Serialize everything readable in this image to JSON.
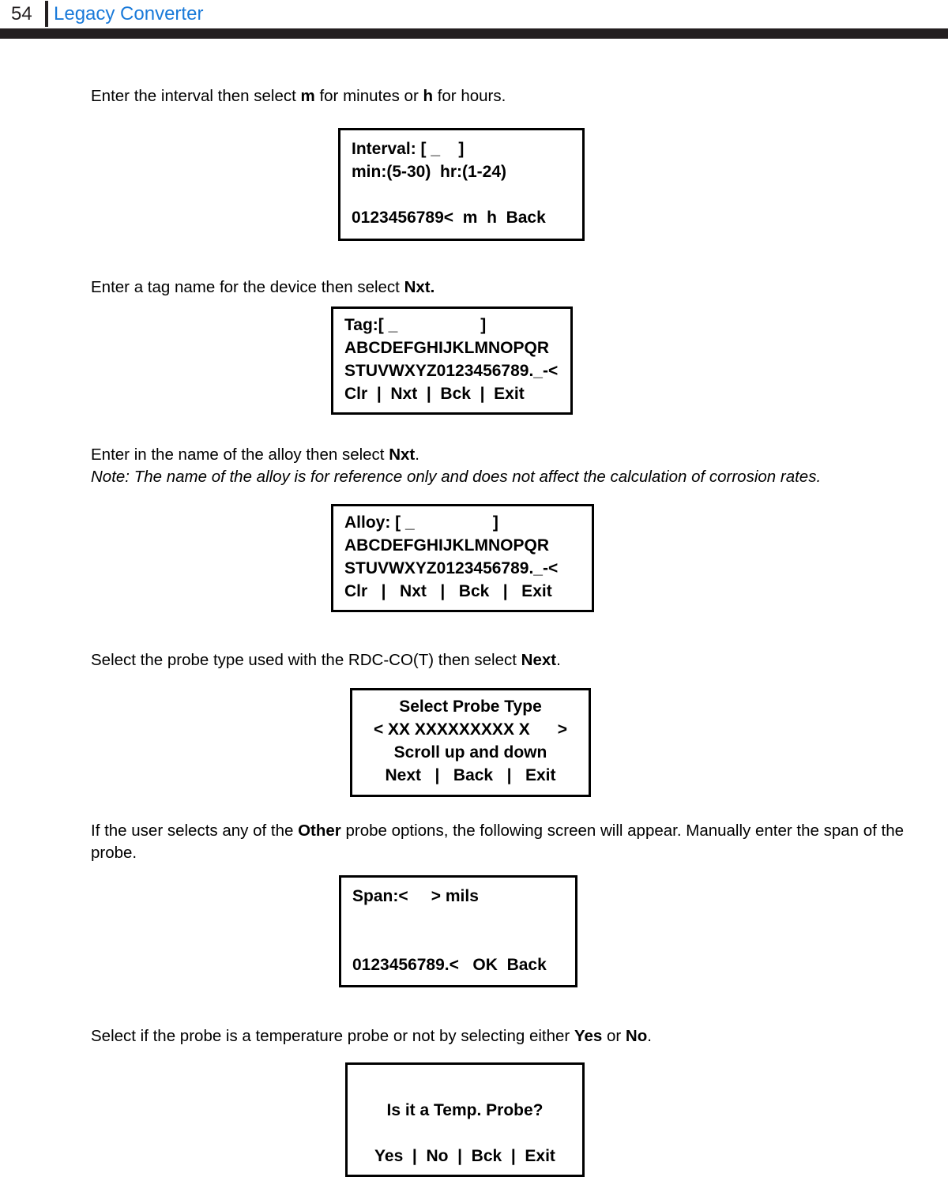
{
  "header": {
    "page_number": "54",
    "title": "Legacy Converter",
    "accent_color": "#1a7ad9",
    "bar_color": "#231f20"
  },
  "sections": [
    {
      "id": "interval",
      "paragraph_parts": {
        "p1": "Enter the interval then select ",
        "b1": "m",
        "p2": " for minutes or ",
        "b2": "h",
        "p3": " for hours."
      },
      "screen": {
        "name": "interval-screen",
        "lines": [
          "Interval: [ _    ]",
          "min:(5-30)  hr:(1-24)",
          "",
          "0123456789<  m  h  Back"
        ]
      }
    },
    {
      "id": "tag",
      "paragraph_parts": {
        "p1": "Enter a tag name for the device then select ",
        "b1": "Nxt.",
        "p2": ""
      },
      "screen": {
        "name": "tag-screen",
        "lines": [
          "Tag:[ _                  ]",
          "ABCDEFGHIJKLMNOPQR",
          "STUVWXYZ0123456789._-<",
          "Clr  |  Nxt  |  Bck  |  Exit"
        ]
      }
    },
    {
      "id": "alloy",
      "paragraph_parts": {
        "p1": "Enter in the name of the alloy then select ",
        "b1": "Nxt",
        "p2": "."
      },
      "note": "Note: The name of the alloy is for reference only and does not affect the calculation of corrosion rates.",
      "screen": {
        "name": "alloy-screen",
        "lines": [
          "Alloy: [ _                 ]",
          "ABCDEFGHIJKLMNOPQR",
          "STUVWXYZ0123456789._-<",
          "Clr   |   Nxt   |   Bck   |   Exit"
        ]
      }
    },
    {
      "id": "probe-type",
      "paragraph_parts": {
        "p1": "Select the probe type used with the RDC-CO(T) then select ",
        "b1": "Next",
        "p2": "."
      },
      "screen": {
        "name": "select-probe-type-screen",
        "lines": [
          "Select Probe Type",
          "< XX XXXXXXXXX X      >",
          "Scroll up and down",
          "Next   |   Back   |   Exit"
        ]
      }
    },
    {
      "id": "span",
      "paragraph_parts": {
        "p1": "If the user selects any of the ",
        "b1": "Other",
        "p2": " probe options, the following screen will appear. Manually enter the span of the probe."
      },
      "screen": {
        "name": "span-screen",
        "lines": [
          "Span:<     > mils",
          "",
          "",
          "0123456789.<   OK  Back"
        ]
      }
    },
    {
      "id": "temp-probe",
      "paragraph_parts": {
        "p1": "Select if the probe is a temperature probe or not by selecting either ",
        "b1": "Yes",
        "p2": " or ",
        "b2": "No",
        "p3": "."
      },
      "screen": {
        "name": "temp-probe-screen",
        "lines": [
          "",
          "Is it a Temp. Probe?",
          "",
          "Yes  |  No  |  Bck  |  Exit"
        ]
      }
    }
  ]
}
